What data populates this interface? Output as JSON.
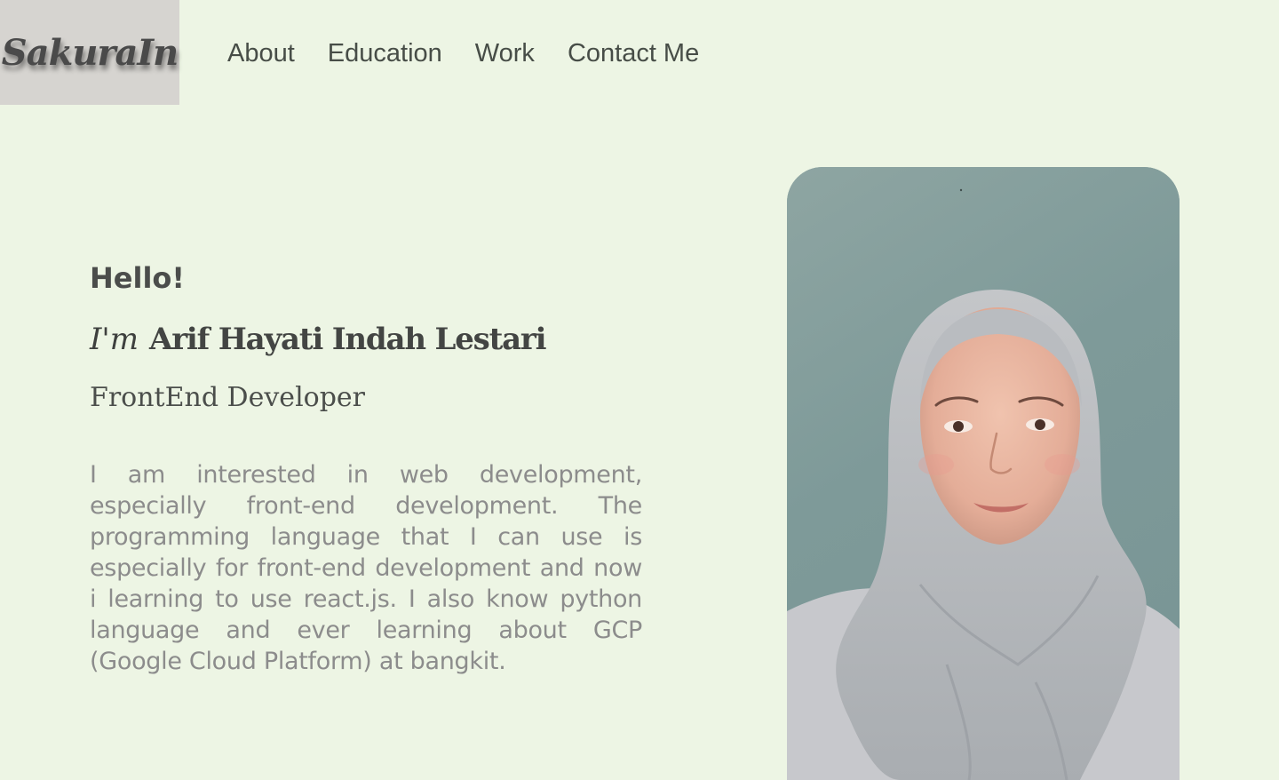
{
  "header": {
    "logo": "SakuraIn",
    "nav": [
      {
        "label": "About"
      },
      {
        "label": "Education"
      },
      {
        "label": "Work"
      },
      {
        "label": "Contact Me"
      }
    ]
  },
  "hero": {
    "greeting": "Hello!",
    "im": "I'm",
    "name": "Arif Hayati Indah Lestari",
    "role": "FrontEnd Developer",
    "bio": "I am interested in web development, especially front-end development. The programming language that I can use is especially for front-end development and now i learning to use react.js. I also know python language and ever learning about GCP (Google Cloud Platform) at bangkit."
  },
  "colors": {
    "background": "#edf5e4",
    "logo_box": "#d6d4d0",
    "text": "#444a44",
    "bio_text": "#8c8c8c",
    "photo_backdrop": "#7f9a99",
    "hijab": "#bcbfc2"
  }
}
